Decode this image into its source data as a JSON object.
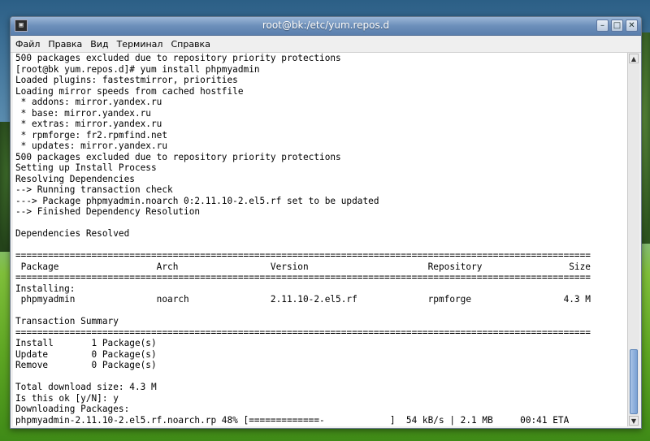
{
  "window": {
    "title": "root@bk:/etc/yum.repos.d",
    "icon_label": "▣",
    "minimize": "–",
    "maximize": "□",
    "close": "✕"
  },
  "menu": [
    "Файл",
    "Правка",
    "Вид",
    "Терминал",
    "Справка"
  ],
  "terminal": {
    "lines": [
      "500 packages excluded due to repository priority protections",
      "[root@bk yum.repos.d]# yum install phpmyadmin",
      "Loaded plugins: fastestmirror, priorities",
      "Loading mirror speeds from cached hostfile",
      " * addons: mirror.yandex.ru",
      " * base: mirror.yandex.ru",
      " * extras: mirror.yandex.ru",
      " * rpmforge: fr2.rpmfind.net",
      " * updates: mirror.yandex.ru",
      "500 packages excluded due to repository priority protections",
      "Setting up Install Process",
      "Resolving Dependencies",
      "--> Running transaction check",
      "---> Package phpmyadmin.noarch 0:2.11.10-2.el5.rf set to be updated",
      "--> Finished Dependency Resolution",
      "",
      "Dependencies Resolved",
      "",
      "==========================================================================================================",
      " Package                  Arch                 Version                      Repository                Size",
      "==========================================================================================================",
      "Installing:",
      " phpmyadmin               noarch               2.11.10-2.el5.rf             rpmforge                 4.3 M",
      "",
      "Transaction Summary",
      "==========================================================================================================",
      "Install       1 Package(s)",
      "Update        0 Package(s)",
      "Remove        0 Package(s)",
      "",
      "Total download size: 4.3 M",
      "Is this ok [y/N]: y",
      "Downloading Packages:",
      "phpmyadmin-2.11.10-2.el5.rf.noarch.rp 48% [=============-            ]  54 kB/s | 2.1 MB     00:41 ETA"
    ]
  },
  "scrollbar": {
    "up": "▲",
    "down": "▼"
  }
}
